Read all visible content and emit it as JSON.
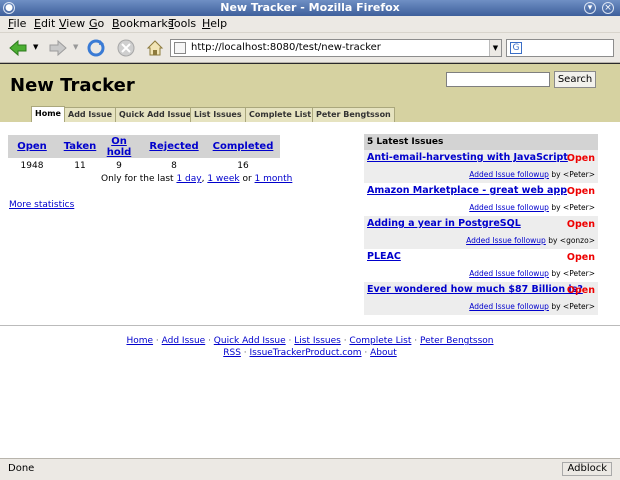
{
  "window": {
    "title": "New Tracker - Mozilla Firefox"
  },
  "menu": [
    {
      "label": "File",
      "u": "F",
      "rest": "ile"
    },
    {
      "label": "Edit",
      "u": "E",
      "rest": "dit"
    },
    {
      "label": "View",
      "u": "V",
      "rest": "iew"
    },
    {
      "label": "Go",
      "u": "G",
      "rest": "o"
    },
    {
      "label": "Bookmarks",
      "u": "B",
      "rest": "ookmarks"
    },
    {
      "label": "Tools",
      "u": "T",
      "rest": "ools"
    },
    {
      "label": "Help",
      "u": "H",
      "rest": "elp"
    }
  ],
  "address": {
    "url": "http://localhost:8080/test/new-tracker"
  },
  "page": {
    "site_title": "New Tracker",
    "search_button": "Search",
    "tabs": [
      "Home",
      "Add Issue",
      "Quick Add Issue",
      "List Issues",
      "Complete List",
      "Peter Bengtsson"
    ],
    "active_tab": "Home"
  },
  "stats": {
    "headers": [
      "Open",
      "Taken",
      "On hold",
      "Rejected",
      "Completed"
    ],
    "values": [
      "1948",
      "11",
      "9",
      "8",
      "16"
    ],
    "only_for": "Only for the last",
    "day": "1 day",
    "week": "1 week",
    "or": "or",
    "month": "1 month",
    "more": "More statistics"
  },
  "latest": {
    "heading": "5 Latest Issues",
    "items": [
      {
        "title": "Anti-email-harvesting with JavaScript",
        "status": "Open",
        "followup": "Added Issue followup",
        "by": "by",
        "who": "<Peter>"
      },
      {
        "title": "Amazon Marketplace - great web app",
        "status": "Open",
        "followup": "Added Issue followup",
        "by": "by",
        "who": "<Peter>"
      },
      {
        "title": "Adding a year in PostgreSQL",
        "status": "Open",
        "followup": "Added Issue followup",
        "by": "by",
        "who": "<gonzo>"
      },
      {
        "title": "PLEAC",
        "status": "Open",
        "followup": "Added Issue followup",
        "by": "by",
        "who": "<Peter>"
      },
      {
        "title": "Ever wondered how much $87 Billion is?",
        "status": "Open",
        "followup": "Added Issue followup",
        "by": "by",
        "who": "<Peter>"
      }
    ]
  },
  "footer": {
    "line1": [
      "Home",
      "Add Issue",
      "Quick Add Issue",
      "List Issues",
      "Complete List",
      "Peter Bengtsson"
    ],
    "line2": [
      "RSS",
      "IssueTrackerProduct.com",
      "About"
    ]
  },
  "status": {
    "text": "Done",
    "adblock": "Adblock"
  },
  "colors": {
    "header_bg": "#d6d2a1",
    "status_open": "#ee0000",
    "link": "#0000cc"
  }
}
